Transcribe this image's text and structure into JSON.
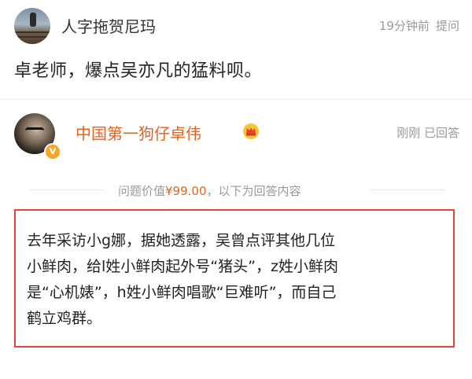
{
  "question": {
    "asker_name": "人字拖贺尼玛",
    "time": "19分钟前",
    "action": "提问",
    "text": "卓老师，爆点吴亦凡的猛料呗。"
  },
  "answer": {
    "answerer_name": "中国第一狗仔卓伟",
    "time": "刚刚",
    "status": "已回答",
    "verified_badge": "V",
    "crown_icon": "crown-icon",
    "price_prefix": "问题价值",
    "price_value": "¥99.00",
    "price_suffix": "，以下为回答内容",
    "lines": [
      "去年采访小g娜，据她透露，吴曾点评其他几位",
      "小鲜肉，给l姓小鲜肉起外号“猪头”，z姓小鲜肉",
      "是“心机婊”，h姓小鲜肉唱歌“巨难听”，而自己",
      "鹤立鸡群。"
    ]
  },
  "colors": {
    "accent": "#e8621a",
    "highlight_border": "#e8433a",
    "muted_text": "#9a9a9a"
  }
}
